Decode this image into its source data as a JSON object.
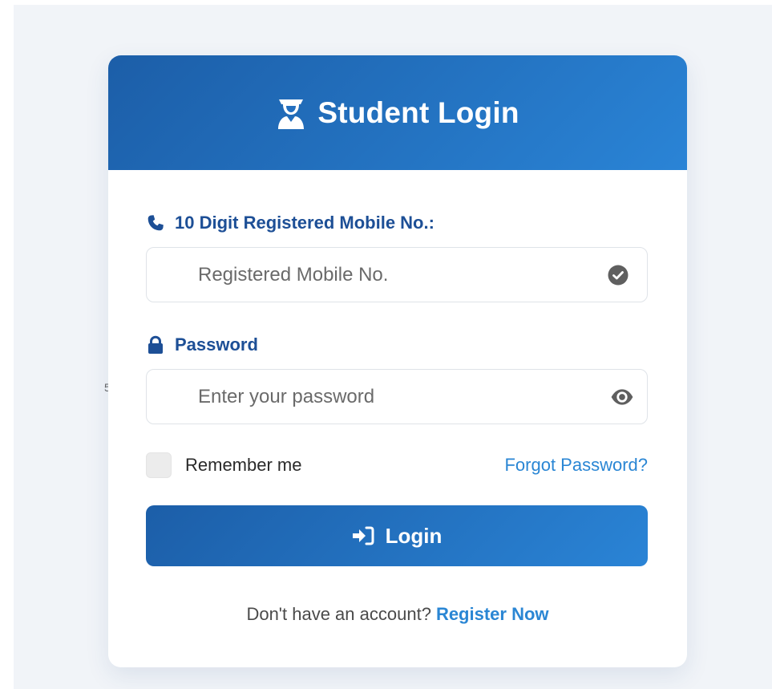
{
  "header": {
    "title": "Student Login",
    "icon": "student-graduate-icon"
  },
  "mobile": {
    "label": "10 Digit Registered Mobile No.:",
    "label_icon": "phone-icon",
    "value": "",
    "placeholder": "Registered Mobile No.",
    "status_icon": "check-circle-icon"
  },
  "password": {
    "label": "Password",
    "label_icon": "lock-icon",
    "value": "",
    "placeholder": "Enter your password",
    "toggle_icon": "eye-icon"
  },
  "remember": {
    "label": "Remember me",
    "checked": false
  },
  "forgot": {
    "label": "Forgot Password?"
  },
  "login_button": {
    "label": "Login",
    "icon": "sign-in-icon"
  },
  "register": {
    "prompt": "Don't have an account?",
    "link": "Register Now"
  },
  "stray_text": "5",
  "colors": {
    "primary_dark": "#1c5ea8",
    "primary_light": "#2a84d6",
    "label_blue": "#1d4f96",
    "link_blue": "#2a86d4",
    "page_background": "#f1f4f8"
  }
}
